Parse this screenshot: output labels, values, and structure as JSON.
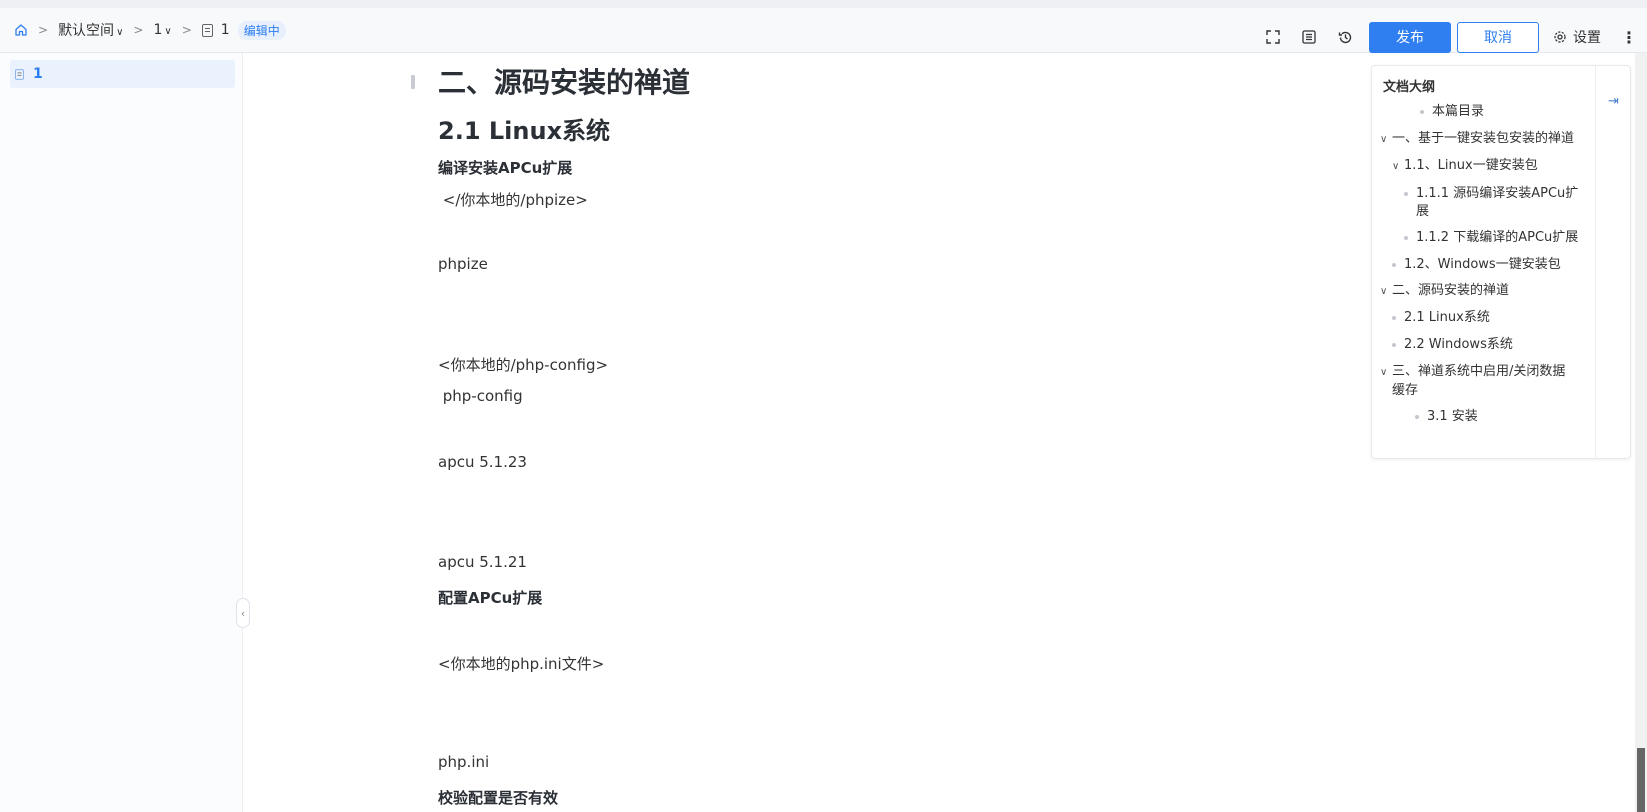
{
  "breadcrumb": {
    "space": "默认空间",
    "book": "1",
    "doc": "1",
    "status": "编辑中"
  },
  "toolbar": {
    "publish": "发布",
    "cancel": "取消",
    "settings": "设置"
  },
  "sidebar": {
    "items": [
      {
        "label": "1"
      }
    ]
  },
  "content": {
    "h1": "二、源码安装的禅道",
    "h2": "2.1 Linux系统",
    "lines": [
      {
        "text": "编译安装APCu扩展",
        "bold": true
      },
      {
        "text": " </你本地的/phpize>",
        "bold": false
      },
      {
        "text": "phpize",
        "bold": false
      },
      {
        "text": "<你本地的/php-config>",
        "bold": false
      },
      {
        "text": " php-config",
        "bold": false
      },
      {
        "text": "apcu 5.1.23",
        "bold": false
      },
      {
        "text": "apcu 5.1.21",
        "bold": false
      },
      {
        "text": "配置APCu扩展",
        "bold": true
      },
      {
        "text": "<你本地的php.ini文件>",
        "bold": false
      },
      {
        "text": "php.ini",
        "bold": false
      },
      {
        "text": "校验配置是否有效",
        "bold": true
      }
    ]
  },
  "outline": {
    "title": "文档大纲",
    "items": [
      {
        "label": "本篇目录"
      },
      {
        "label": "一、基于一键安装包安装的禅道"
      },
      {
        "label": "1.1、Linux一键安装包"
      },
      {
        "label": "1.1.1 源码编译安装APCu扩"
      },
      {
        "label": "展"
      },
      {
        "label": "1.1.2 下载编译的APCu扩展"
      },
      {
        "label": "1.2、Windows一键安装包"
      },
      {
        "label": "二、源码安装的禅道"
      },
      {
        "label": "2.1 Linux系统"
      },
      {
        "label": "2.2 Windows系统"
      },
      {
        "label": "三、禅道系统中启用/关闭数据"
      },
      {
        "label": "缓存"
      },
      {
        "label": "3.1 安装"
      }
    ]
  },
  "icons": {
    "home": "home-icon",
    "fullscreen": "fullscreen-icon",
    "outline": "outline-icon",
    "history": "history-icon",
    "settings": "gear-icon",
    "more": "more-icon",
    "collapse": "collapse-icon"
  },
  "colors": {
    "accent": "#2f7ff0",
    "badge_bg": "#e8f0fe"
  }
}
